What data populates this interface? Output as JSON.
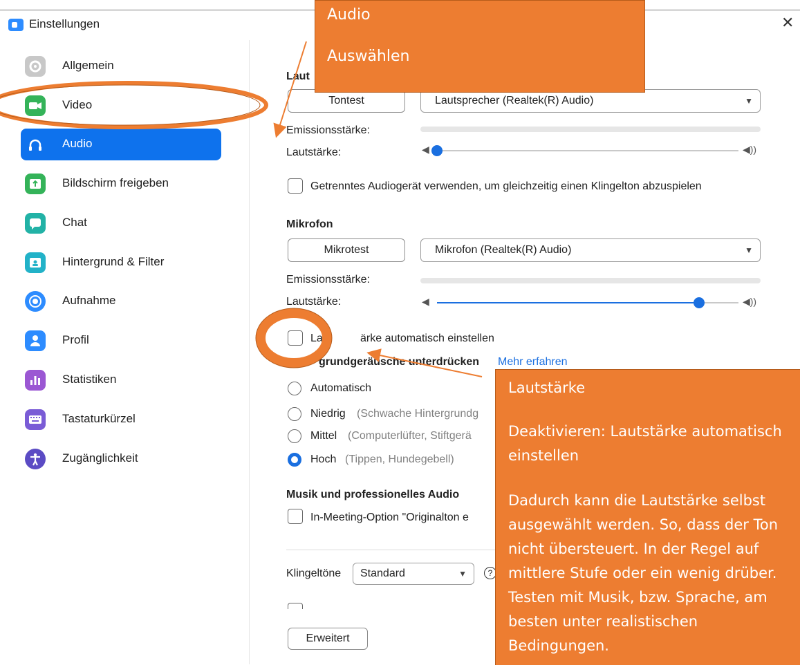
{
  "window": {
    "title": "Einstellungen"
  },
  "sidebar": {
    "items": [
      {
        "label": "Allgemein",
        "icon": "gear-icon",
        "color": "#c8c8c8"
      },
      {
        "label": "Video",
        "icon": "video-camera-icon",
        "color": "#34b359"
      },
      {
        "label": "Audio",
        "icon": "headphones-icon",
        "color": "#ffffff"
      },
      {
        "label": "Bildschirm freigeben",
        "icon": "share-screen-icon",
        "color": "#34b359"
      },
      {
        "label": "Chat",
        "icon": "chat-bubble-icon",
        "color": "#22b2a6"
      },
      {
        "label": "Hintergrund & Filter",
        "icon": "person-frame-icon",
        "color": "#22b2c8"
      },
      {
        "label": "Aufnahme",
        "icon": "record-icon",
        "color": "#2d8cff"
      },
      {
        "label": "Profil",
        "icon": "user-icon",
        "color": "#2d8cff"
      },
      {
        "label": "Statistiken",
        "icon": "bar-chart-icon",
        "color": "#9b57d3"
      },
      {
        "label": "Tastaturkürzel",
        "icon": "keyboard-icon",
        "color": "#7a5cd6"
      },
      {
        "label": "Zugänglichkeit",
        "icon": "accessibility-icon",
        "color": "#5b4bc4"
      }
    ]
  },
  "speaker": {
    "heading": "Laut",
    "test_button": "Tontest",
    "device": "Lautsprecher (Realtek(R) Audio)",
    "output_level_label": "Emissionsstärke:",
    "volume_label": "Lautstärke:",
    "volume_level": 0.0
  },
  "separate_device": {
    "label": "Getrenntes Audiogerät verwenden, um gleichzeitig einen Klingelton abzuspielen",
    "checked": false
  },
  "microphone": {
    "heading": "Mikrofon",
    "test_button": "Mikrotest",
    "device": "Mikrofon (Realtek(R) Audio)",
    "input_level_label": "Emissionsstärke:",
    "volume_label": "Lautstärke:",
    "volume_level": 0.87
  },
  "auto_volume": {
    "label_start": "La",
    "label_end": "ärke automatisch einstellen",
    "checked": false
  },
  "noise": {
    "heading": "grundgeräusche unterdrücken",
    "link": "Mehr erfahren",
    "options": [
      {
        "label": "Automatisch",
        "hint": ""
      },
      {
        "label": "Niedrig",
        "hint": "(Schwache Hintergrundg"
      },
      {
        "label": "Mittel",
        "hint": "(Computerlüfter, Stiftgerä"
      },
      {
        "label": "Hoch",
        "hint": "(Tippen, Hundegebell)"
      }
    ],
    "selected_index": 3
  },
  "music": {
    "heading": "Musik und professionelles Audio",
    "option": "In-Meeting-Option \"Originalton e"
  },
  "ringtones": {
    "label": "Klingeltöne",
    "value": "Standard",
    "help": "?"
  },
  "advanced_button": "Erweitert",
  "callouts": {
    "top": {
      "line1": "Audio",
      "line2": "Auswählen"
    },
    "right": {
      "title": "Lautstärke",
      "line1": "Deaktivieren: Lautstärke automatisch einstellen",
      "line2": "Dadurch kann die Lautstärke selbst ausgewählt werden. So, dass der Ton nicht übersteuert. In der Regel auf mittlere Stufe oder ein wenig drüber. Testen mit Musik, bzw. Sprache, am besten unter realistischen Bedingungen."
    }
  },
  "colors": {
    "accent": "#0e72ed",
    "annotation": "#ed7d31",
    "slider": "#1a6fe0"
  }
}
